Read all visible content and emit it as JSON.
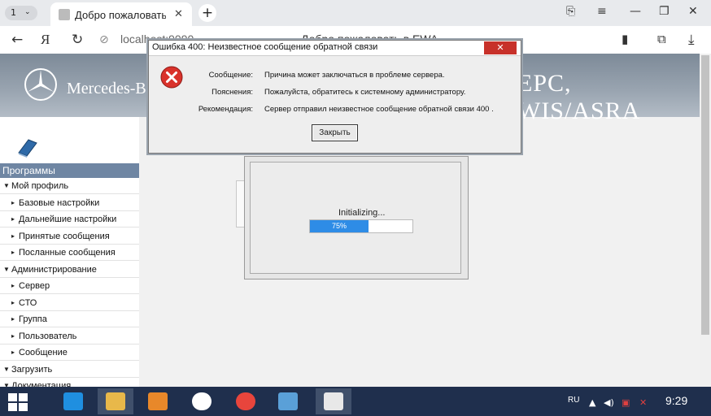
{
  "browser": {
    "tab_count": "1",
    "tab_title": "Добро пожаловать в EWA",
    "url": "localhost:9090",
    "page_title": "Добро пожаловать в EWA"
  },
  "banner": {
    "brand": "Mercedes-Benz",
    "app_title": "EPC, WIS/ASRA"
  },
  "sidebar": {
    "header": "Программы",
    "items": [
      {
        "label": "Мой профиль",
        "level": 0
      },
      {
        "label": "Базовые настройки",
        "level": 1
      },
      {
        "label": "Дальнейшие настройки",
        "level": 1
      },
      {
        "label": "Принятые сообщения",
        "level": 1
      },
      {
        "label": "Посланные сообщения",
        "level": 1
      },
      {
        "label": "Администрирование",
        "level": 0
      },
      {
        "label": "Сервер",
        "level": 1
      },
      {
        "label": "СТО",
        "level": 1
      },
      {
        "label": "Группа",
        "level": 1
      },
      {
        "label": "Пользователь",
        "level": 1
      },
      {
        "label": "Сообщение",
        "level": 1
      },
      {
        "label": "Загрузить",
        "level": 0
      },
      {
        "label": "Документация",
        "level": 0
      }
    ]
  },
  "loader": {
    "label": "Initializing...",
    "progress": 0.75,
    "progress_text": "75%"
  },
  "dialog": {
    "title": "Ошибка 400: Неизвестное сообщение обратной связи",
    "close_glyph": "✕",
    "rows": [
      {
        "label": "Сообщение:",
        "value": "Причина может заключаться в проблеме сервера."
      },
      {
        "label": "Пояснения:",
        "value": "Пожалуйста, обратитесь к системному администратору."
      },
      {
        "label": "Рекомендация:",
        "value": "Сервер отправил неизвестное сообщение обратной связи 400 ."
      }
    ],
    "ok_label": "Закрыть"
  },
  "taskbar": {
    "lang": "RU",
    "clock": "9:29",
    "apps": [
      {
        "name": "internet-explorer",
        "color": "#1f8fe0"
      },
      {
        "name": "file-explorer",
        "color": "#e8b84a"
      },
      {
        "name": "media-player",
        "color": "#e8882a"
      },
      {
        "name": "yandex-browser",
        "color": "#ffffff"
      },
      {
        "name": "chrome",
        "color": "#e8453c"
      },
      {
        "name": "control-panel",
        "color": "#5aa0d8"
      },
      {
        "name": "java",
        "color": "#e8e8e8"
      }
    ]
  },
  "colors": {
    "sidebar_header": "#6f86a3",
    "progress_fill": "#2e8ce6",
    "error_red": "#d9322b",
    "taskbar": "#1f2f4d"
  }
}
